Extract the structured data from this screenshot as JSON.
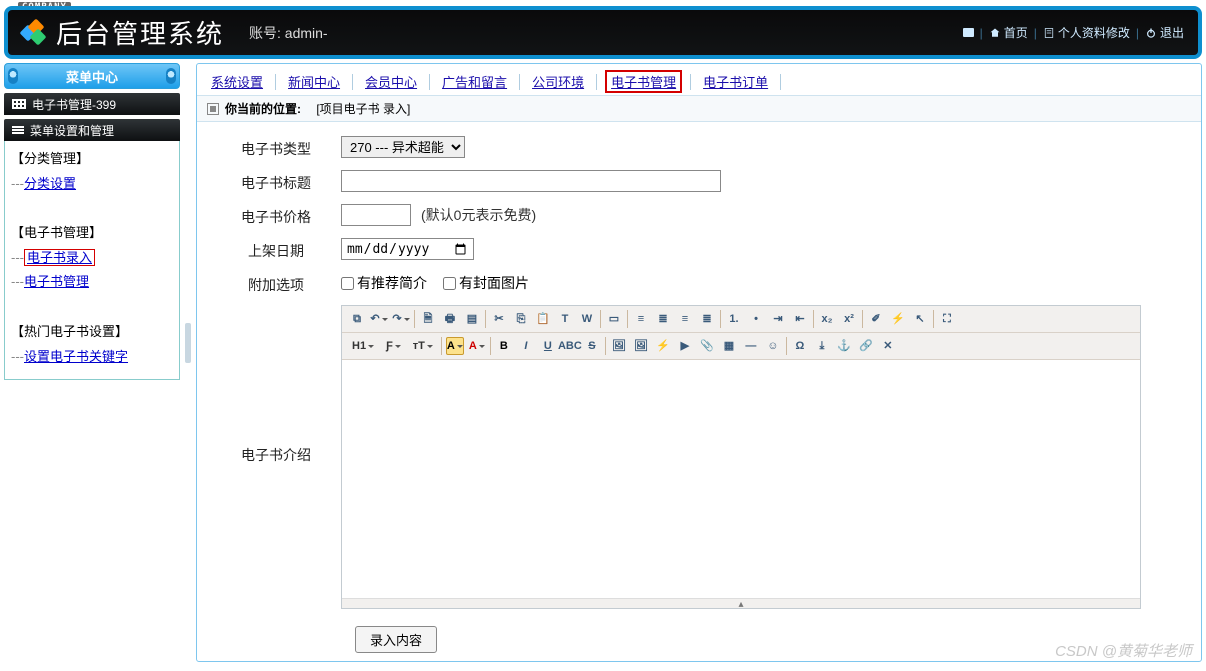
{
  "company_tag": "COMPANY",
  "header": {
    "title": "后台管理系统",
    "account_label": "账号:",
    "account_value": "admin-",
    "links": {
      "home": "首页",
      "profile": "个人资料修改",
      "logout": "退出"
    }
  },
  "sidebar": {
    "center_title": "菜单中心",
    "section1": "电子书管理-399",
    "section2": "菜单设置和管理",
    "g1": {
      "title": "【分类管理】",
      "items": [
        {
          "label": "分类设置"
        }
      ]
    },
    "g2": {
      "title": "【电子书管理】",
      "items": [
        {
          "label": "电子书录入",
          "hl": true
        },
        {
          "label": "电子书管理"
        }
      ]
    },
    "g3": {
      "title": "【热门电子书设置】",
      "items": [
        {
          "label": "设置电子书关键字"
        }
      ]
    }
  },
  "tabs": [
    {
      "label": "系统设置"
    },
    {
      "label": "新闻中心"
    },
    {
      "label": "会员中心"
    },
    {
      "label": "广告和留言"
    },
    {
      "label": "公司环境"
    },
    {
      "label": "电子书管理",
      "hl": true
    },
    {
      "label": "电子书订单"
    }
  ],
  "breadcrumb": {
    "prefix": "你当前的位置:",
    "value": "[项目电子书 录入]"
  },
  "form": {
    "type_label": "电子书类型",
    "type_option": "270 --- 异术超能",
    "title_label": "电子书标题",
    "title_value": "",
    "price_label": "电子书价格",
    "price_value": "",
    "price_hint": "(默认0元表示免费)",
    "date_label": "上架日期",
    "date_placeholder": "年 / 月 / 日",
    "extra_label": "附加选项",
    "extra1": "有推荐简介",
    "extra2": "有封面图片",
    "intro_label": "电子书介绍",
    "submit": "录入内容"
  },
  "editor": {
    "row1": [
      "source-icon",
      "undo-icon",
      "redo-icon",
      "sep",
      "preview-icon",
      "print-icon",
      "template-icon",
      "sep",
      "cut-icon",
      "copy-icon",
      "paste-icon",
      "paste-plain-icon",
      "paste-word-icon",
      "sep",
      "select-all-icon",
      "sep",
      "align-left-icon",
      "align-center-icon",
      "align-right-icon",
      "align-justify-icon",
      "sep",
      "list-ol-icon",
      "list-ul-icon",
      "indent-icon",
      "outdent-icon",
      "sep",
      "subscript-icon",
      "superscript-icon",
      "sep",
      "eraser-icon",
      "quickformat-icon",
      "select-tool-icon",
      "sep",
      "fullscreen-icon"
    ],
    "row2": [
      "h1-label",
      "font-family-icon",
      "font-size-icon",
      "sep",
      "bg-color-icon",
      "text-color-icon",
      "sep",
      "bold-icon",
      "italic-icon",
      "underline-icon",
      "abc-icon",
      "strikethrough-icon",
      "sep",
      "image-icon",
      "multi-image-icon",
      "flash-icon",
      "media-icon",
      "attach-icon",
      "table-icon",
      "hr-icon",
      "emoji-icon",
      "sep",
      "char-icon",
      "pagebreak-icon",
      "anchor-icon",
      "link-icon",
      "unlink-icon"
    ]
  },
  "watermark": "CSDN @黄菊华老师"
}
